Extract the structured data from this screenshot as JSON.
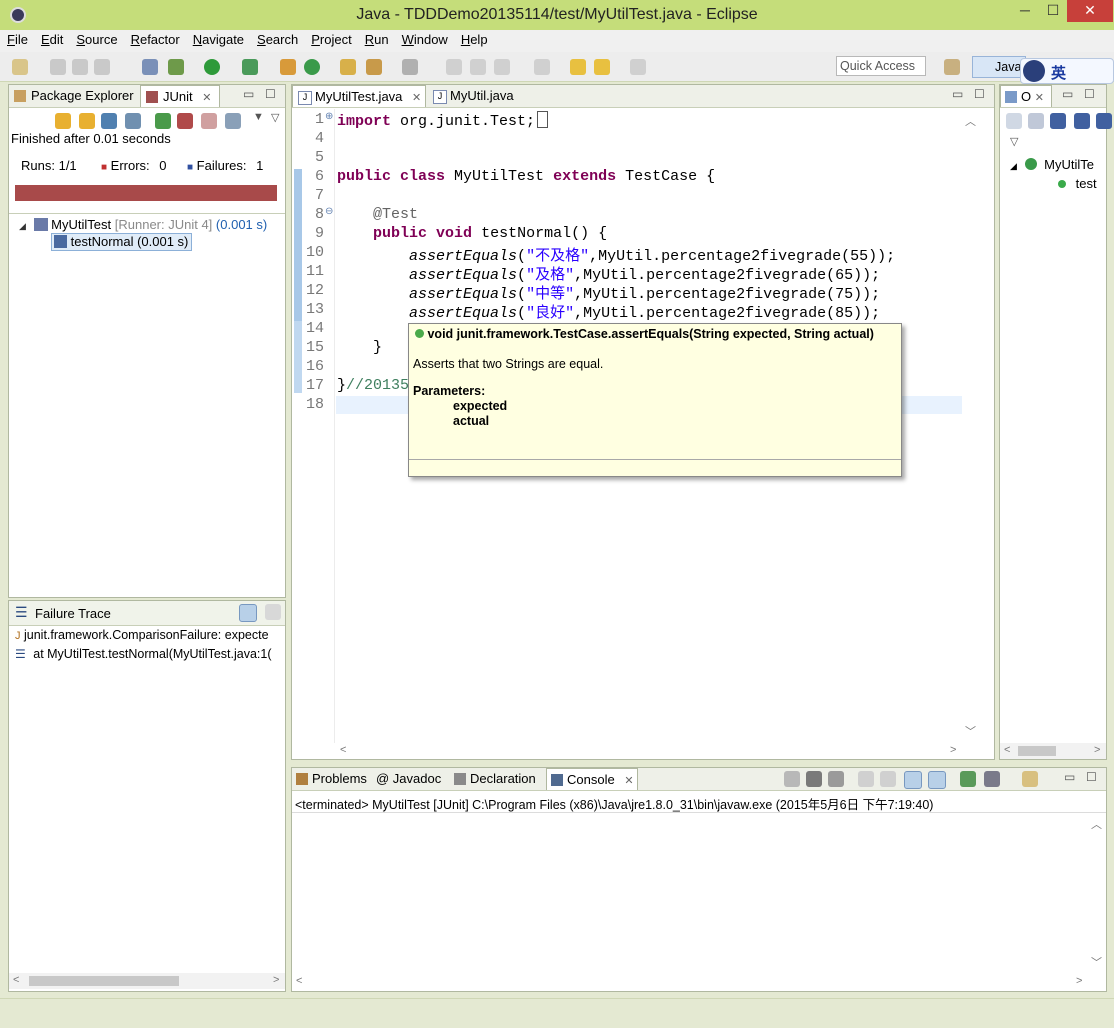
{
  "window": {
    "title": "Java - TDDDemo20135114/test/MyUtilTest.java - Eclipse",
    "minimize": "─",
    "maximize": "☐",
    "close": "✕"
  },
  "menu": [
    "File",
    "Edit",
    "Source",
    "Refactor",
    "Navigate",
    "Search",
    "Project",
    "Run",
    "Window",
    "Help"
  ],
  "toolbar": {
    "quick_access": "Quick Access",
    "perspective": "Java",
    "ime": "英"
  },
  "left_panel": {
    "tabs": [
      {
        "label": "Package Explorer"
      },
      {
        "label": "JUnit"
      }
    ],
    "status": "Finished after 0.01 seconds",
    "runs_label": "Runs:",
    "runs": "1/1",
    "errors_label": "Errors:",
    "errors": "0",
    "failures_label": "Failures:",
    "failures": "1",
    "tree": [
      {
        "name": "MyUtilTest",
        "runner": "[Runner: JUnit 4]",
        "time": "(0.001 s)"
      },
      {
        "name": "testNormal (0.001 s)"
      }
    ]
  },
  "failure_trace": {
    "title": "Failure Trace",
    "lines": [
      "junit.framework.ComparisonFailure: expecte",
      "at MyUtilTest.testNormal(MyUtilTest.java:1("
    ]
  },
  "editor": {
    "tabs": [
      {
        "label": "MyUtilTest.java"
      },
      {
        "label": "MyUtil.java"
      }
    ],
    "lines": [
      {
        "n": "1",
        "t1": "import",
        "t2": " org.junit.Test;"
      },
      {
        "n": "4"
      },
      {
        "n": "5"
      },
      {
        "n": "6",
        "t1": "public",
        "t2": " ",
        "t3": "class",
        "t4": " MyUtilTest ",
        "t5": "extends",
        "t6": " TestCase {"
      },
      {
        "n": "7"
      },
      {
        "n": "8",
        "t1": "    @Test"
      },
      {
        "n": "9",
        "t1": "    ",
        "t2": "public",
        "t3": " ",
        "t4": "void",
        "t5": " testNormal() {"
      },
      {
        "n": "10",
        "m": "assertEquals",
        "s": "\"不及格\"",
        "r": ",MyUtil.percentage2fivegrade(55));"
      },
      {
        "n": "11",
        "m": "assertEquals",
        "s": "\"及格\"",
        "r": ",MyUtil.percentage2fivegrade(65));"
      },
      {
        "n": "12",
        "m": "assertEquals",
        "s": "\"中等\"",
        "r": ",MyUtil.percentage2fivegrade(75));"
      },
      {
        "n": "13",
        "m": "assertEquals",
        "s": "\"良好\"",
        "r": ",MyUtil.percentage2fivegrade(85));"
      },
      {
        "n": "14"
      },
      {
        "n": "15",
        "t1": "    }"
      },
      {
        "n": "16"
      },
      {
        "n": "17",
        "t1": "}",
        "c": "//20135"
      },
      {
        "n": "18"
      }
    ]
  },
  "tooltip": {
    "signature": "void junit.framework.TestCase.assertEquals(String expected, String actual)",
    "description": "Asserts that two Strings are equal.",
    "params_label": "Parameters:",
    "params": [
      "expected",
      "actual"
    ]
  },
  "outline": {
    "tab": "O",
    "items": [
      "MyUtilTe",
      "test"
    ]
  },
  "bottom": {
    "tabs": [
      {
        "label": "Problems"
      },
      {
        "label": "@ Javadoc"
      },
      {
        "label": "Declaration"
      },
      {
        "label": "Console"
      }
    ],
    "console_status": "<terminated> MyUtilTest [JUnit] C:\\Program Files (x86)\\Java\\jre1.8.0_31\\bin\\javaw.exe (2015年5月6日 下午7:19:40)"
  },
  "colors": {
    "titlebar": "#c5dd7a",
    "failure_bar": "#a84a4a",
    "keyword": "#7f0055",
    "string": "#2a00ff",
    "tooltip_bg": "#ffffe1"
  }
}
